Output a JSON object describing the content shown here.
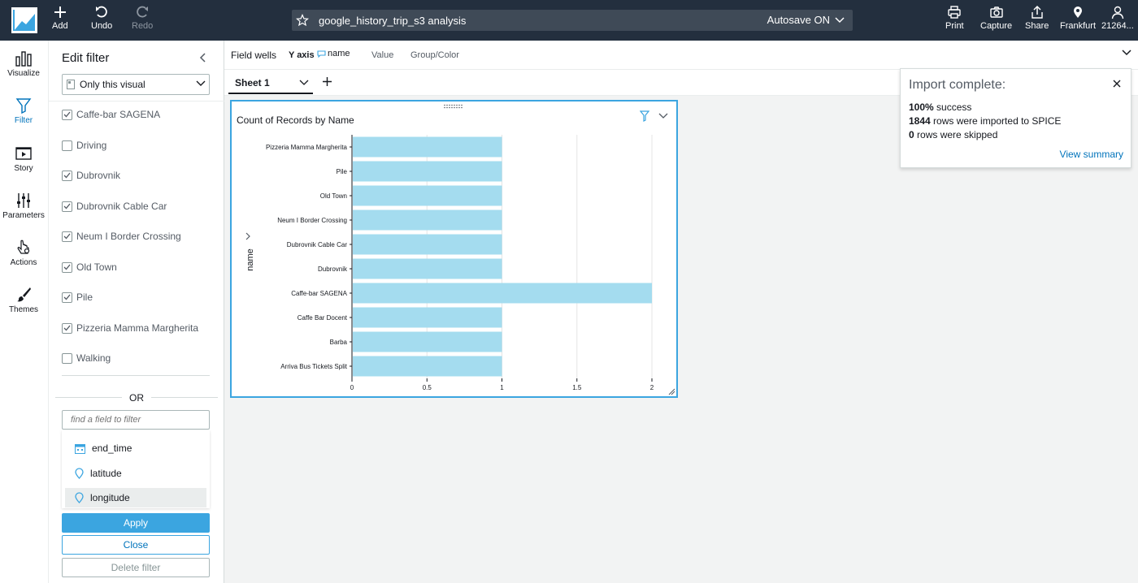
{
  "topbar": {
    "add_label": "Add",
    "undo_label": "Undo",
    "redo_label": "Redo",
    "analysis_title": "google_history_trip_s3 analysis",
    "autosave_label": "Autosave ON",
    "print_label": "Print",
    "capture_label": "Capture",
    "share_label": "Share",
    "region_label": "Frankfurt",
    "account_label": "21264..."
  },
  "leftnav": {
    "items": [
      {
        "label": "Visualize",
        "icon": "bar-chart-icon"
      },
      {
        "label": "Filter",
        "icon": "filter-icon",
        "active": true
      },
      {
        "label": "Story",
        "icon": "story-icon"
      },
      {
        "label": "Parameters",
        "icon": "sliders-icon"
      },
      {
        "label": "Actions",
        "icon": "pointer-icon"
      },
      {
        "label": "Themes",
        "icon": "brush-icon"
      }
    ]
  },
  "filter_panel": {
    "title": "Edit filter",
    "scope": "Only this visual",
    "values": [
      {
        "label": "Caffe-bar SAGENA",
        "checked": true
      },
      {
        "label": "Driving",
        "checked": false
      },
      {
        "label": "Dubrovnik",
        "checked": true
      },
      {
        "label": "Dubrovnik Cable Car",
        "checked": true
      },
      {
        "label": "Neum I Border Crossing",
        "checked": true
      },
      {
        "label": "Old Town",
        "checked": true
      },
      {
        "label": "Pile",
        "checked": true
      },
      {
        "label": "Pizzeria Mamma Margherita",
        "checked": true
      },
      {
        "label": "Walking",
        "checked": false
      }
    ],
    "or_label": "OR",
    "find_placeholder": "find a field to filter",
    "fields": [
      {
        "label": "end_time",
        "icon": "calendar-icon"
      },
      {
        "label": "latitude",
        "icon": "geo-pin-icon"
      },
      {
        "label": "longitude",
        "icon": "geo-pin-icon"
      }
    ],
    "apply_label": "Apply",
    "close_label": "Close",
    "delete_label": "Delete filter"
  },
  "field_wells": {
    "title": "Field wells",
    "y_axis_label": "Y axis",
    "y_axis_field": "name",
    "value_label": "Value",
    "group_label": "Group/Color"
  },
  "sheets": {
    "active": "Sheet 1"
  },
  "visual": {
    "title": "Count of Records by Name"
  },
  "chart_data": {
    "type": "bar",
    "orientation": "horizontal",
    "title": "Count of Records by Name",
    "ylabel": "name",
    "xlabel": "",
    "categories": [
      "Pizzeria Mamma Margherita",
      "Pile",
      "Old Town",
      "Neum I Border Crossing",
      "Dubrovnik Cable Car",
      "Dubrovnik",
      "Caffe-bar SAGENA",
      "Caffe Bar Docent",
      "Barba",
      "Arriva Bus Tickets Split"
    ],
    "values": [
      1,
      1,
      1,
      1,
      1,
      1,
      2,
      1,
      1,
      1
    ],
    "xlim": [
      0,
      2
    ],
    "xticks": [
      "0",
      "0.5",
      "1",
      "1.5",
      "2"
    ],
    "bar_color": "#a4dcef",
    "grid": true
  },
  "toast": {
    "title": "Import complete:",
    "line1_bold": "100%",
    "line1_rest": " success",
    "line2_bold": "1844",
    "line2_rest": " rows were imported to SPICE",
    "line3_bold": "0",
    "line3_rest": " rows were skipped",
    "link": "View summary"
  },
  "colors": {
    "topbar_bg": "#232f3e",
    "accent": "#0073bb",
    "primary_button": "#3ba5e0"
  }
}
